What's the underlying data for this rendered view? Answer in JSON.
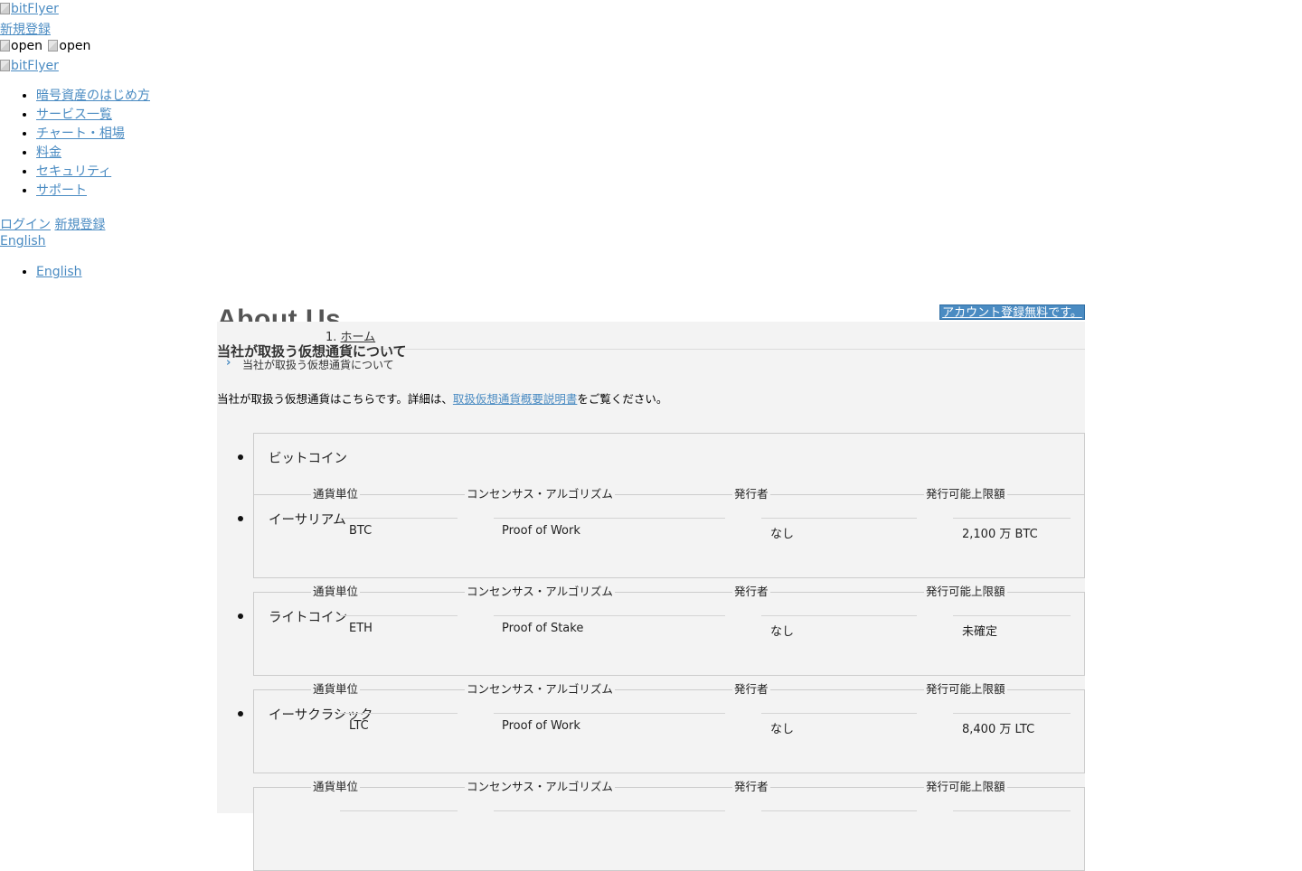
{
  "header": {
    "logo_alt": "bitFlyer",
    "signup_label": "新規登録",
    "menu_open_alt_1": "open",
    "menu_open_alt_2": "open",
    "logo_alt_2": "bitFlyer"
  },
  "nav": {
    "items": [
      {
        "label": "暗号資産のはじめ方"
      },
      {
        "label": "サービス一覧"
      },
      {
        "label": "チャート・相場"
      },
      {
        "label": "料金"
      },
      {
        "label": "セキュリティ"
      },
      {
        "label": "サポート"
      }
    ]
  },
  "account": {
    "login_label": "ログイン",
    "signup_label": "新規登録"
  },
  "language": {
    "current": "English",
    "options": [
      {
        "label": "English"
      }
    ]
  },
  "page": {
    "hero_title": "About Us",
    "cta_label": "アカウント登録無料です。",
    "breadcrumb_home": "ホーム",
    "breadcrumb_number": "1.",
    "breadcrumb_current": "当社が取扱う仮想通貨について",
    "heading": "当社が取扱う仮想通貨について",
    "intro_before": "当社が取扱う仮想通貨はこちらです。詳細は、",
    "intro_link": "取扱仮想通貨概要説明書",
    "intro_after": "をご覧ください。"
  },
  "table_headers": {
    "unit": "通貨単位",
    "algorithm": "コンセンサス・アルゴリズム",
    "issuer": "発行者",
    "supply": "発行可能上限額"
  },
  "currencies": [
    {
      "name": "ビットコイン",
      "unit": "BTC",
      "algorithm": "Proof of Work",
      "issuer": "なし",
      "supply": "2,100 万 BTC"
    },
    {
      "name": "イーサリアム",
      "unit": "ETH",
      "algorithm": "Proof of Stake",
      "issuer": "なし",
      "supply": "未確定"
    },
    {
      "name": "ライトコイン",
      "unit": "LTC",
      "algorithm": "Proof of Work",
      "issuer": "なし",
      "supply": "8,400 万 LTC"
    },
    {
      "name": "イーサクラシック",
      "unit": "",
      "algorithm": "",
      "issuer": "",
      "supply": ""
    }
  ]
}
